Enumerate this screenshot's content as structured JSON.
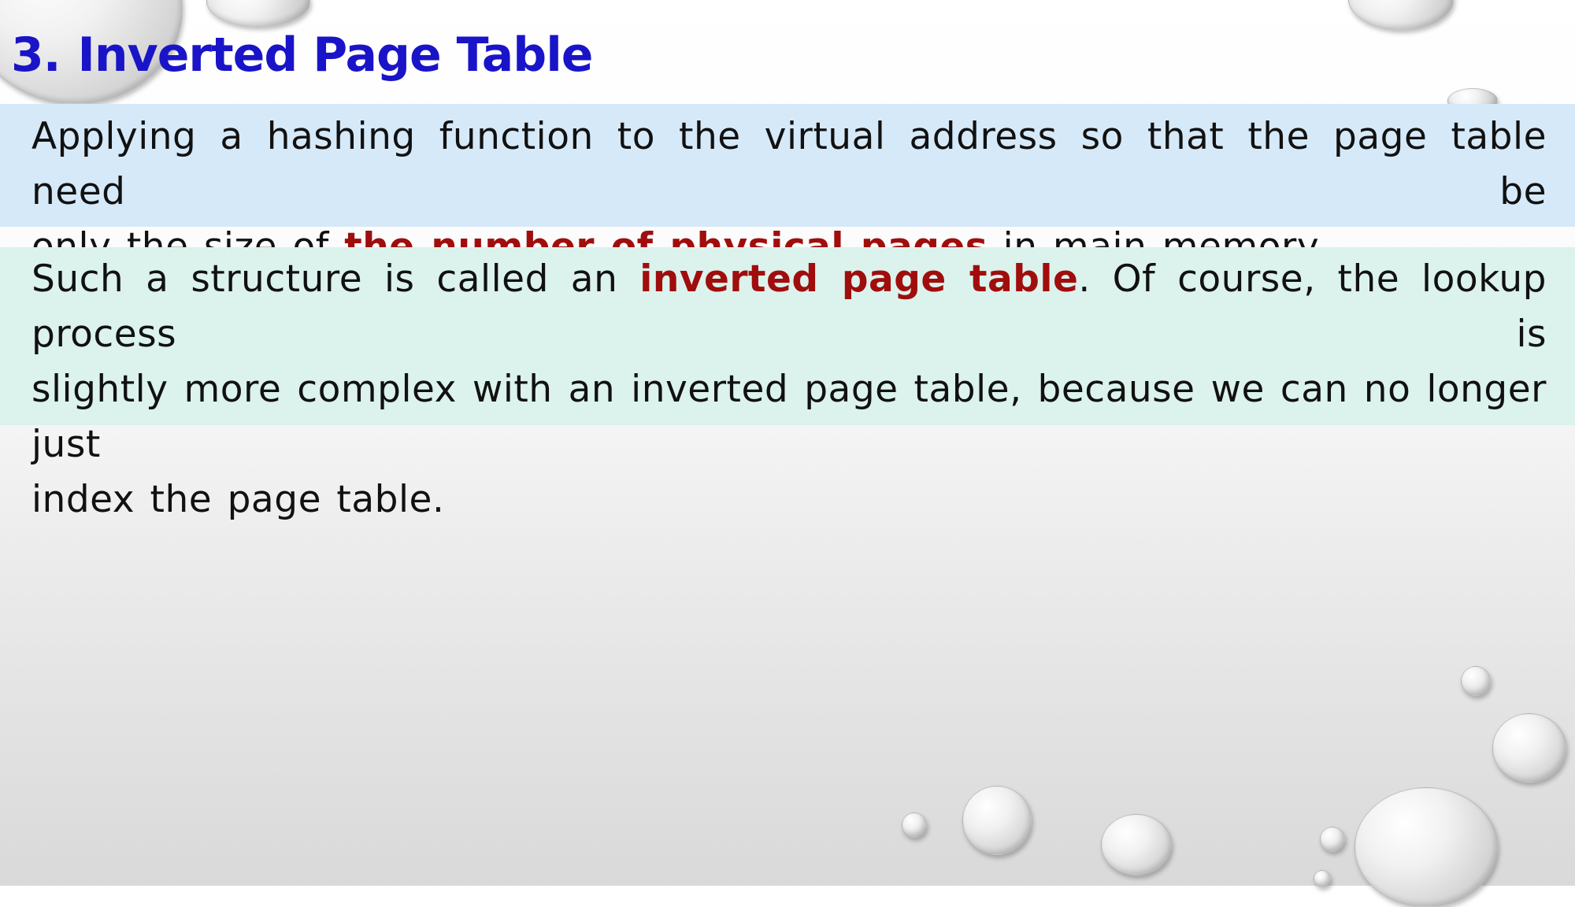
{
  "slide": {
    "title_number": "3.",
    "title_text": "Inverted Page Table",
    "para1": {
      "line1": "Applying a hashing function to the virtual address so that the page table need be",
      "line2_pre": "only the size of ",
      "line2_highlight": "the number of physical pages",
      "line2_post": " in main memory."
    },
    "para2": {
      "line1_pre": "Such a structure is called an ",
      "line1_highlight": "inverted page table",
      "line1_post": ". Of course, the lookup process is",
      "line2": "slightly more complex with an inverted page table, because we can no longer just",
      "line3": "index the page table."
    }
  },
  "colors": {
    "title": "#1a14c8",
    "highlight": "#a00d0d",
    "box1_bg": "#d6e9f8",
    "box2_bg": "#dcf2ec"
  }
}
